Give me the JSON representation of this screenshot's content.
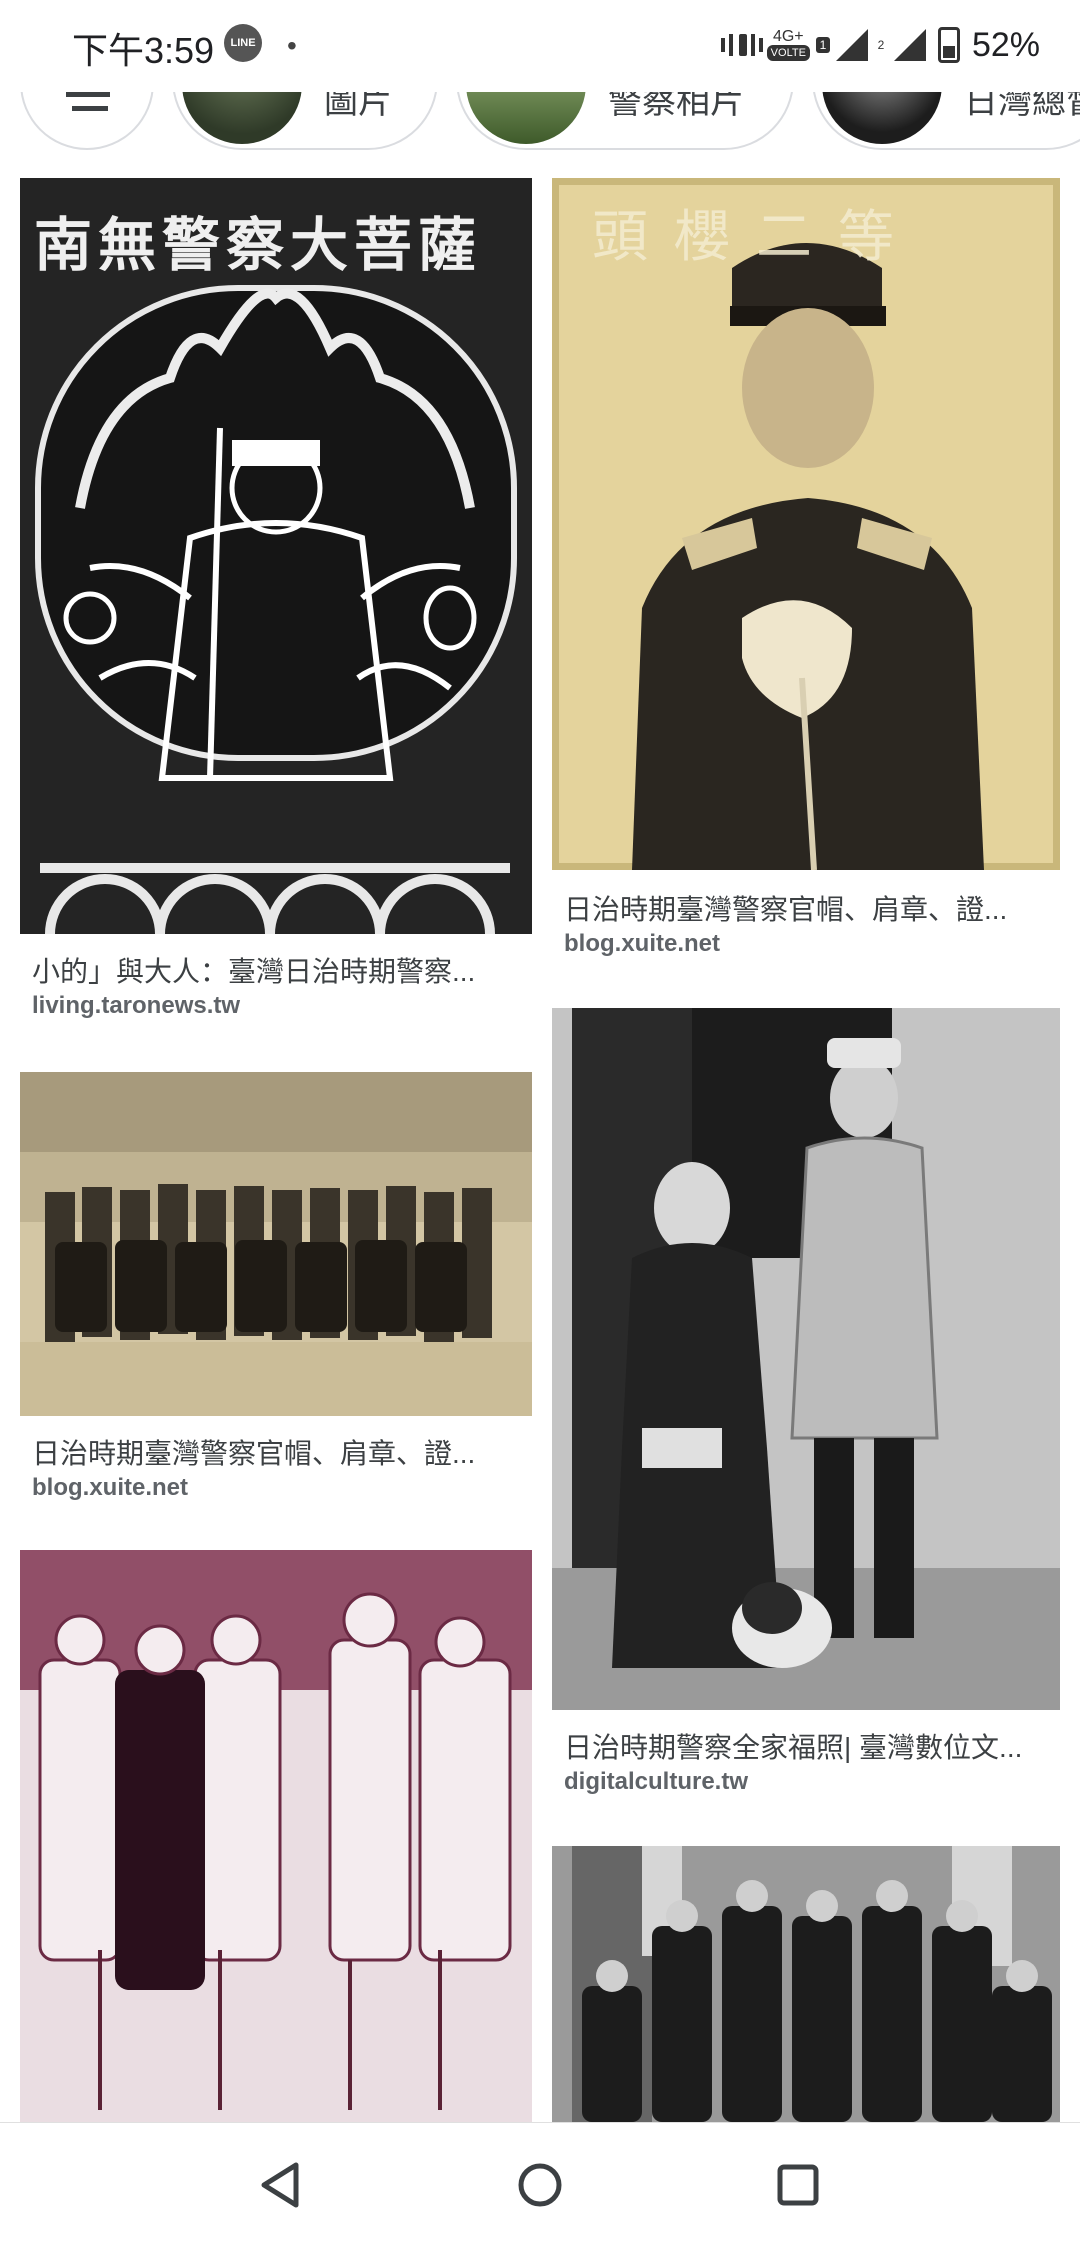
{
  "status_bar": {
    "time": "下午3:59",
    "line_badge": "LINE",
    "dot": "•",
    "network": "4G+",
    "volte": "VOLTE",
    "sim1": "1",
    "sim2": "2",
    "battery": "52%"
  },
  "chips": {
    "chip1_label": "圖片",
    "chip2_label": "警察相片",
    "chip3_label": "日灣總督"
  },
  "results": [
    {
      "title": "小的」與大人：臺灣日治時期警察...",
      "source": "living.taronews.tw",
      "image_text": "南無警察大菩薩"
    },
    {
      "title": "日治時期臺灣警察官帽、肩章、證...",
      "source": "blog.xuite.net",
      "image_text": "頭櫻二等"
    },
    {
      "title": "日治時期臺灣警察官帽、肩章、證...",
      "source": "blog.xuite.net"
    },
    {
      "title": "日治時期警察全家福照| 臺灣數位文...",
      "source": "digitalculture.tw"
    },
    {
      "title": "",
      "source": ""
    },
    {
      "title": "",
      "source": ""
    }
  ],
  "icons": {
    "back": "back-icon",
    "home": "home-icon",
    "recents": "recents-icon"
  }
}
